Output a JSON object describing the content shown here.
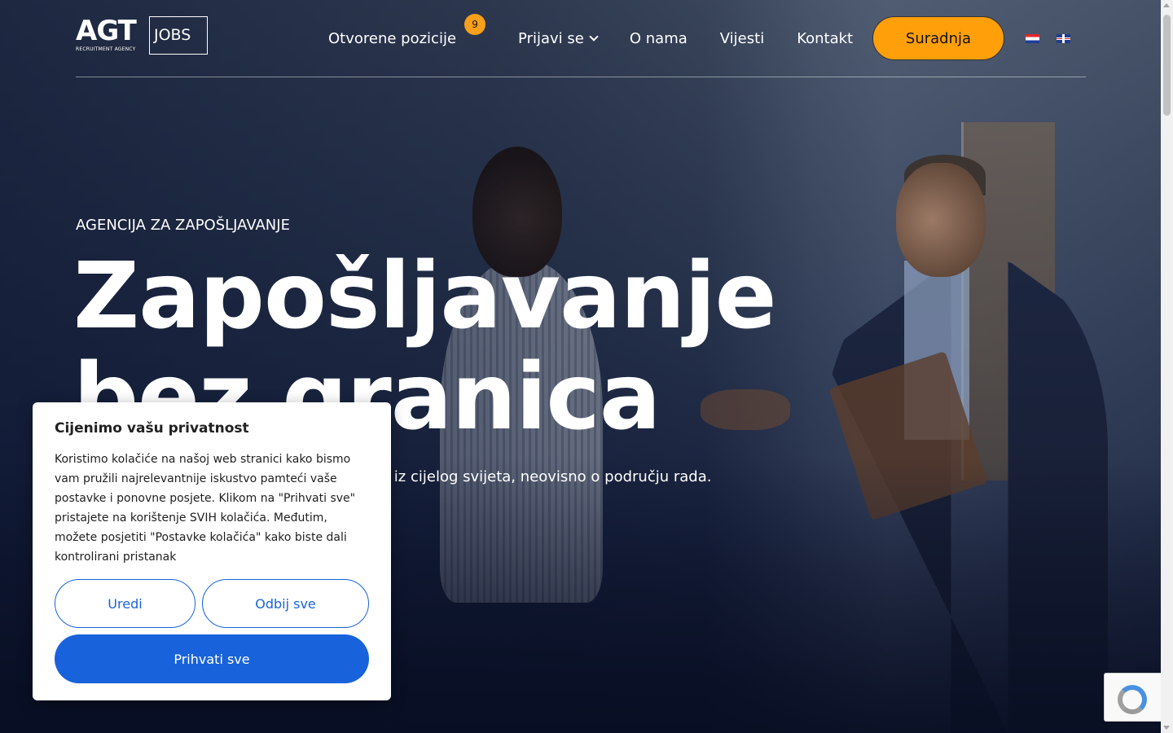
{
  "logo": {
    "main": "AGT",
    "sub": "RECRUITMENT AGENCY",
    "boxed": "JOBS"
  },
  "nav": {
    "items": [
      {
        "label": "Otvorene pozicije",
        "badge": "9"
      },
      {
        "label": "Prijavi se"
      },
      {
        "label": "O nama"
      },
      {
        "label": "Vijesti"
      },
      {
        "label": "Kontakt"
      }
    ],
    "cta": "Suradnja",
    "languages": [
      "hr",
      "en"
    ]
  },
  "hero": {
    "eyebrow": "AGENCIJA ZA ZAPOŠLJAVANJE",
    "headline_line1": "Zapošljavanje",
    "headline_line2": "bez granica",
    "subline": "e iz cijelog svijeta, neovisno o području rada."
  },
  "cookie": {
    "title": "Cijenimo vašu privatnost",
    "text": "Koristimo kolačiće na našoj web stranici kako bismo vam pružili najrelevantnije iskustvo pamteći vaše postavke i ponovne posjete. Klikom na \"Prihvati sve\" pristajete na korištenje SVIH kolačića. Međutim, možete posjetiti \"Postavke kolačića\" kako biste dali kontrolirani pristanak",
    "edit": "Uredi",
    "reject": "Odbij sve",
    "accept": "Prihvati sve"
  },
  "colors": {
    "accent": "#ff9f0a",
    "primary_button": "#1863dc",
    "hero_dark": "#0c1530"
  }
}
